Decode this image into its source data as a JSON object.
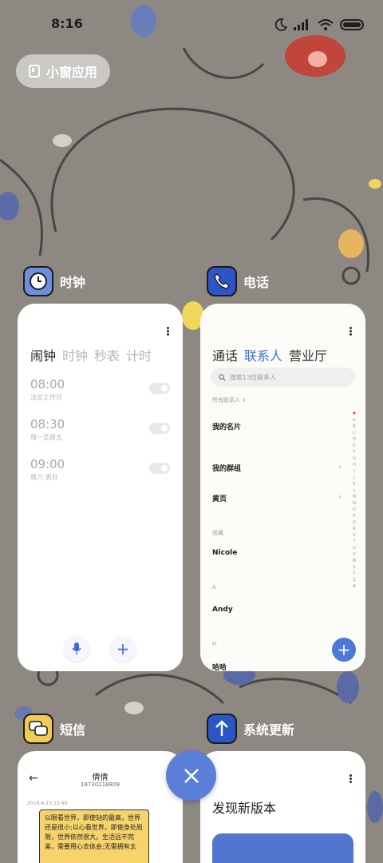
{
  "status_bar": {
    "time": "8:16"
  },
  "small_window_button": {
    "label": "小窗应用"
  },
  "apps": {
    "clock": {
      "name": "时钟",
      "tabs": [
        "闹钟",
        "时钟",
        "秒表",
        "计时"
      ],
      "alarms": [
        {
          "time": "08:00",
          "desc": "法定工作日"
        },
        {
          "time": "08:30",
          "desc": "周一至周五"
        },
        {
          "time": "09:00",
          "desc": "周六 周日"
        }
      ]
    },
    "phone": {
      "name": "电话",
      "tabs": [
        "通话",
        "联系人",
        "营业厅"
      ],
      "search_placeholder": "搜索13位联系人",
      "filter_label": "所有联系人",
      "rows": {
        "my_card": "我的名片",
        "my_groups": "我的群组",
        "yellow_pages": "黄页"
      },
      "section_favorites": "收藏",
      "contact1": "Nicole",
      "section_a": "A",
      "contact2": "Andy",
      "section_h": "H",
      "contact3": "哈哈",
      "alphabet": [
        "♥",
        "A",
        "B",
        "C",
        "D",
        "E",
        "F",
        "G",
        "H",
        "I",
        "J",
        "K",
        "L",
        "M",
        "N",
        "O",
        "P",
        "Q",
        "R",
        "S",
        "T",
        "U",
        "V",
        "W",
        "X",
        "Y",
        "Z",
        "#"
      ]
    },
    "sms": {
      "name": "短信",
      "contact_name": "倩倩",
      "number": "18730218809",
      "date": "2016-6-13 13:49",
      "message": "以眼看世界，即使站的最高，世界还是很小;以心看世界，即使身处局限，世界依然很大。生活远不完美，需要用心去体会;无需拥有太"
    },
    "update": {
      "name": "系统更新",
      "title": "发现新版本"
    }
  },
  "colors": {
    "accent": "#3a73d8",
    "fab": "#5b7ed8",
    "sms_bubble": "#f6d36b"
  }
}
